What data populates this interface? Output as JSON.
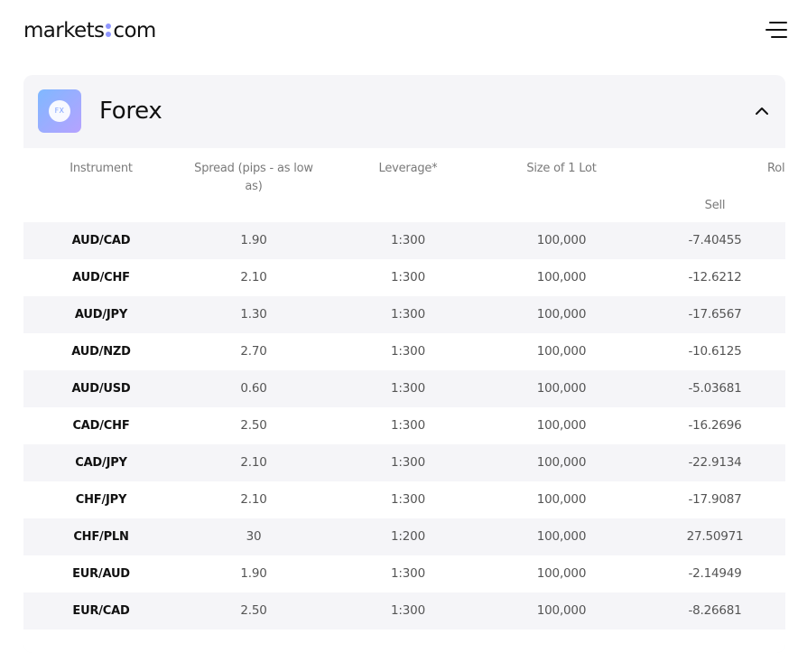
{
  "header": {
    "logo_left": "markets",
    "logo_right": "com"
  },
  "panel": {
    "icon_text": "FX",
    "title": "Forex"
  },
  "table": {
    "columns": {
      "instrument": "Instrument",
      "spread": "Spread (pips - as low as)",
      "leverage": "Leverage*",
      "lot_size": "Size of 1 Lot",
      "rollover": "Rol",
      "sell": "Sell"
    },
    "rows": [
      {
        "instrument": "AUD/CAD",
        "spread": "1.90",
        "leverage": "1:300",
        "lot": "100,000",
        "sell": "-7.40455"
      },
      {
        "instrument": "AUD/CHF",
        "spread": "2.10",
        "leverage": "1:300",
        "lot": "100,000",
        "sell": "-12.6212"
      },
      {
        "instrument": "AUD/JPY",
        "spread": "1.30",
        "leverage": "1:300",
        "lot": "100,000",
        "sell": "-17.6567"
      },
      {
        "instrument": "AUD/NZD",
        "spread": "2.70",
        "leverage": "1:300",
        "lot": "100,000",
        "sell": "-10.6125"
      },
      {
        "instrument": "AUD/USD",
        "spread": "0.60",
        "leverage": "1:300",
        "lot": "100,000",
        "sell": "-5.03681"
      },
      {
        "instrument": "CAD/CHF",
        "spread": "2.50",
        "leverage": "1:300",
        "lot": "100,000",
        "sell": "-16.2696"
      },
      {
        "instrument": "CAD/JPY",
        "spread": "2.10",
        "leverage": "1:300",
        "lot": "100,000",
        "sell": "-22.9134"
      },
      {
        "instrument": "CHF/JPY",
        "spread": "2.10",
        "leverage": "1:300",
        "lot": "100,000",
        "sell": "-17.9087"
      },
      {
        "instrument": "CHF/PLN",
        "spread": "30",
        "leverage": "1:200",
        "lot": "100,000",
        "sell": "27.50971"
      },
      {
        "instrument": "EUR/AUD",
        "spread": "1.90",
        "leverage": "1:300",
        "lot": "100,000",
        "sell": "-2.14949"
      },
      {
        "instrument": "EUR/CAD",
        "spread": "2.50",
        "leverage": "1:300",
        "lot": "100,000",
        "sell": "-8.26681"
      }
    ]
  },
  "icons": {
    "menu": "hamburger-menu-icon",
    "collapse": "chevron-up-icon",
    "category": "fx-icon"
  },
  "colors": {
    "logo_dots": "#8f96ff",
    "panel_bg": "#f5f5f8",
    "icon_gradient_start": "#7fb8ff",
    "icon_gradient_end": "#b6a2ff"
  }
}
